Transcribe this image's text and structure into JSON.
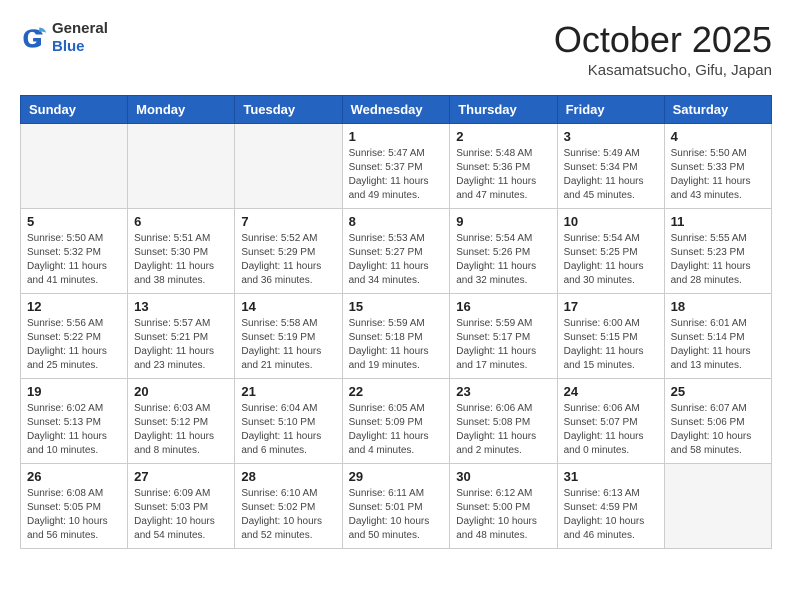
{
  "header": {
    "logo_general": "General",
    "logo_blue": "Blue",
    "month_title": "October 2025",
    "location": "Kasamatsucho, Gifu, Japan"
  },
  "weekdays": [
    "Sunday",
    "Monday",
    "Tuesday",
    "Wednesday",
    "Thursday",
    "Friday",
    "Saturday"
  ],
  "weeks": [
    [
      {
        "day": "",
        "info": ""
      },
      {
        "day": "",
        "info": ""
      },
      {
        "day": "",
        "info": ""
      },
      {
        "day": "1",
        "info": "Sunrise: 5:47 AM\nSunset: 5:37 PM\nDaylight: 11 hours\nand 49 minutes."
      },
      {
        "day": "2",
        "info": "Sunrise: 5:48 AM\nSunset: 5:36 PM\nDaylight: 11 hours\nand 47 minutes."
      },
      {
        "day": "3",
        "info": "Sunrise: 5:49 AM\nSunset: 5:34 PM\nDaylight: 11 hours\nand 45 minutes."
      },
      {
        "day": "4",
        "info": "Sunrise: 5:50 AM\nSunset: 5:33 PM\nDaylight: 11 hours\nand 43 minutes."
      }
    ],
    [
      {
        "day": "5",
        "info": "Sunrise: 5:50 AM\nSunset: 5:32 PM\nDaylight: 11 hours\nand 41 minutes."
      },
      {
        "day": "6",
        "info": "Sunrise: 5:51 AM\nSunset: 5:30 PM\nDaylight: 11 hours\nand 38 minutes."
      },
      {
        "day": "7",
        "info": "Sunrise: 5:52 AM\nSunset: 5:29 PM\nDaylight: 11 hours\nand 36 minutes."
      },
      {
        "day": "8",
        "info": "Sunrise: 5:53 AM\nSunset: 5:27 PM\nDaylight: 11 hours\nand 34 minutes."
      },
      {
        "day": "9",
        "info": "Sunrise: 5:54 AM\nSunset: 5:26 PM\nDaylight: 11 hours\nand 32 minutes."
      },
      {
        "day": "10",
        "info": "Sunrise: 5:54 AM\nSunset: 5:25 PM\nDaylight: 11 hours\nand 30 minutes."
      },
      {
        "day": "11",
        "info": "Sunrise: 5:55 AM\nSunset: 5:23 PM\nDaylight: 11 hours\nand 28 minutes."
      }
    ],
    [
      {
        "day": "12",
        "info": "Sunrise: 5:56 AM\nSunset: 5:22 PM\nDaylight: 11 hours\nand 25 minutes."
      },
      {
        "day": "13",
        "info": "Sunrise: 5:57 AM\nSunset: 5:21 PM\nDaylight: 11 hours\nand 23 minutes."
      },
      {
        "day": "14",
        "info": "Sunrise: 5:58 AM\nSunset: 5:19 PM\nDaylight: 11 hours\nand 21 minutes."
      },
      {
        "day": "15",
        "info": "Sunrise: 5:59 AM\nSunset: 5:18 PM\nDaylight: 11 hours\nand 19 minutes."
      },
      {
        "day": "16",
        "info": "Sunrise: 5:59 AM\nSunset: 5:17 PM\nDaylight: 11 hours\nand 17 minutes."
      },
      {
        "day": "17",
        "info": "Sunrise: 6:00 AM\nSunset: 5:15 PM\nDaylight: 11 hours\nand 15 minutes."
      },
      {
        "day": "18",
        "info": "Sunrise: 6:01 AM\nSunset: 5:14 PM\nDaylight: 11 hours\nand 13 minutes."
      }
    ],
    [
      {
        "day": "19",
        "info": "Sunrise: 6:02 AM\nSunset: 5:13 PM\nDaylight: 11 hours\nand 10 minutes."
      },
      {
        "day": "20",
        "info": "Sunrise: 6:03 AM\nSunset: 5:12 PM\nDaylight: 11 hours\nand 8 minutes."
      },
      {
        "day": "21",
        "info": "Sunrise: 6:04 AM\nSunset: 5:10 PM\nDaylight: 11 hours\nand 6 minutes."
      },
      {
        "day": "22",
        "info": "Sunrise: 6:05 AM\nSunset: 5:09 PM\nDaylight: 11 hours\nand 4 minutes."
      },
      {
        "day": "23",
        "info": "Sunrise: 6:06 AM\nSunset: 5:08 PM\nDaylight: 11 hours\nand 2 minutes."
      },
      {
        "day": "24",
        "info": "Sunrise: 6:06 AM\nSunset: 5:07 PM\nDaylight: 11 hours\nand 0 minutes."
      },
      {
        "day": "25",
        "info": "Sunrise: 6:07 AM\nSunset: 5:06 PM\nDaylight: 10 hours\nand 58 minutes."
      }
    ],
    [
      {
        "day": "26",
        "info": "Sunrise: 6:08 AM\nSunset: 5:05 PM\nDaylight: 10 hours\nand 56 minutes."
      },
      {
        "day": "27",
        "info": "Sunrise: 6:09 AM\nSunset: 5:03 PM\nDaylight: 10 hours\nand 54 minutes."
      },
      {
        "day": "28",
        "info": "Sunrise: 6:10 AM\nSunset: 5:02 PM\nDaylight: 10 hours\nand 52 minutes."
      },
      {
        "day": "29",
        "info": "Sunrise: 6:11 AM\nSunset: 5:01 PM\nDaylight: 10 hours\nand 50 minutes."
      },
      {
        "day": "30",
        "info": "Sunrise: 6:12 AM\nSunset: 5:00 PM\nDaylight: 10 hours\nand 48 minutes."
      },
      {
        "day": "31",
        "info": "Sunrise: 6:13 AM\nSunset: 4:59 PM\nDaylight: 10 hours\nand 46 minutes."
      },
      {
        "day": "",
        "info": ""
      }
    ]
  ]
}
